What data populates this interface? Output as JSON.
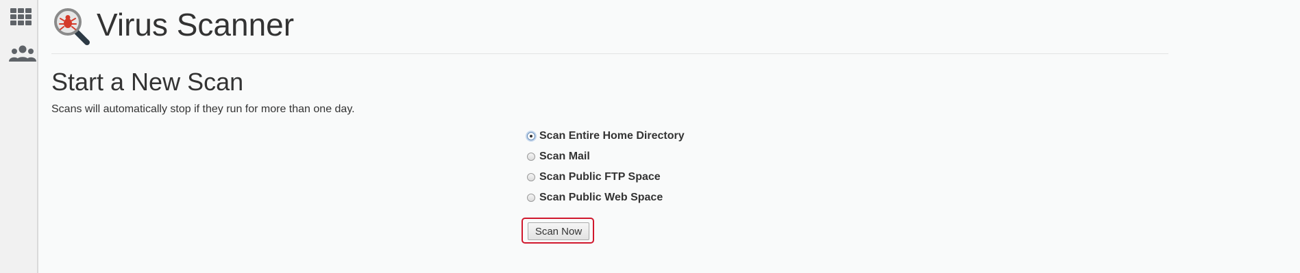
{
  "sidebar": {
    "icons": [
      {
        "name": "apps-grid-icon"
      },
      {
        "name": "users-icon"
      }
    ]
  },
  "header": {
    "title": "Virus Scanner",
    "icon": "virus-search-icon"
  },
  "section": {
    "title": "Start a New Scan",
    "description": "Scans will automatically stop if they run for more than one day."
  },
  "scan_options": [
    {
      "label": "Scan Entire Home Directory",
      "selected": true
    },
    {
      "label": "Scan Mail",
      "selected": false
    },
    {
      "label": "Scan Public FTP Space",
      "selected": false
    },
    {
      "label": "Scan Public Web Space",
      "selected": false
    }
  ],
  "scan_button": {
    "label": "Scan Now"
  },
  "colors": {
    "highlight": "#d0172c",
    "bug": "#d43a2a",
    "icon_gray": "#5f6368"
  }
}
